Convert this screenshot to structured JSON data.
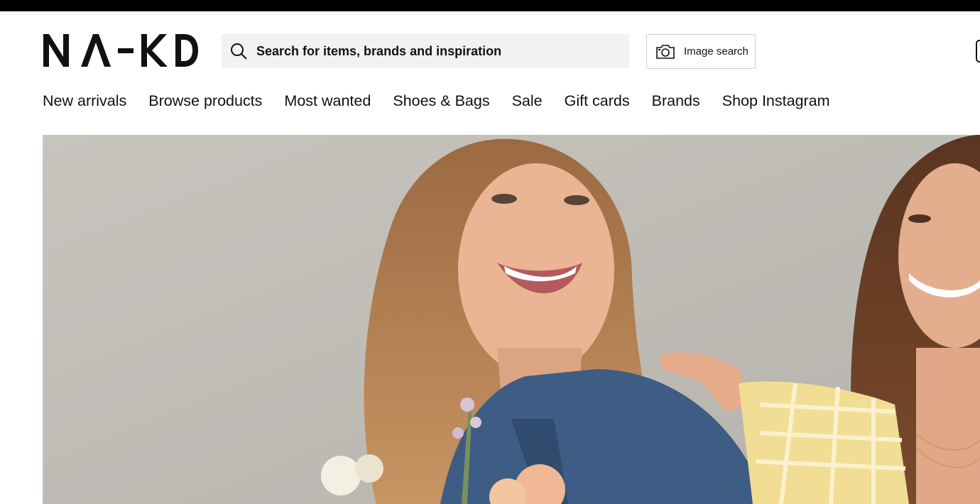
{
  "brand": {
    "logo_text": "NA-KD"
  },
  "search": {
    "placeholder": "Search for items, brands and inspiration",
    "value": "",
    "icon": "search-icon"
  },
  "image_search": {
    "label": "Image search",
    "icon": "camera-icon"
  },
  "nav": {
    "items": [
      {
        "label": "New arrivals"
      },
      {
        "label": "Browse products"
      },
      {
        "label": "Most wanted"
      },
      {
        "label": "Shoes & Bags"
      },
      {
        "label": "Sale"
      },
      {
        "label": "Gift cards"
      },
      {
        "label": "Brands"
      },
      {
        "label": "Shop Instagram"
      }
    ]
  },
  "hero": {
    "description_icon": "hero-banner-image"
  },
  "colors": {
    "top_strip": "#000000",
    "background": "#ffffff",
    "search_bg": "#f2f2f2",
    "text": "#111111",
    "hero_backdrop": "#c2bfb9"
  }
}
